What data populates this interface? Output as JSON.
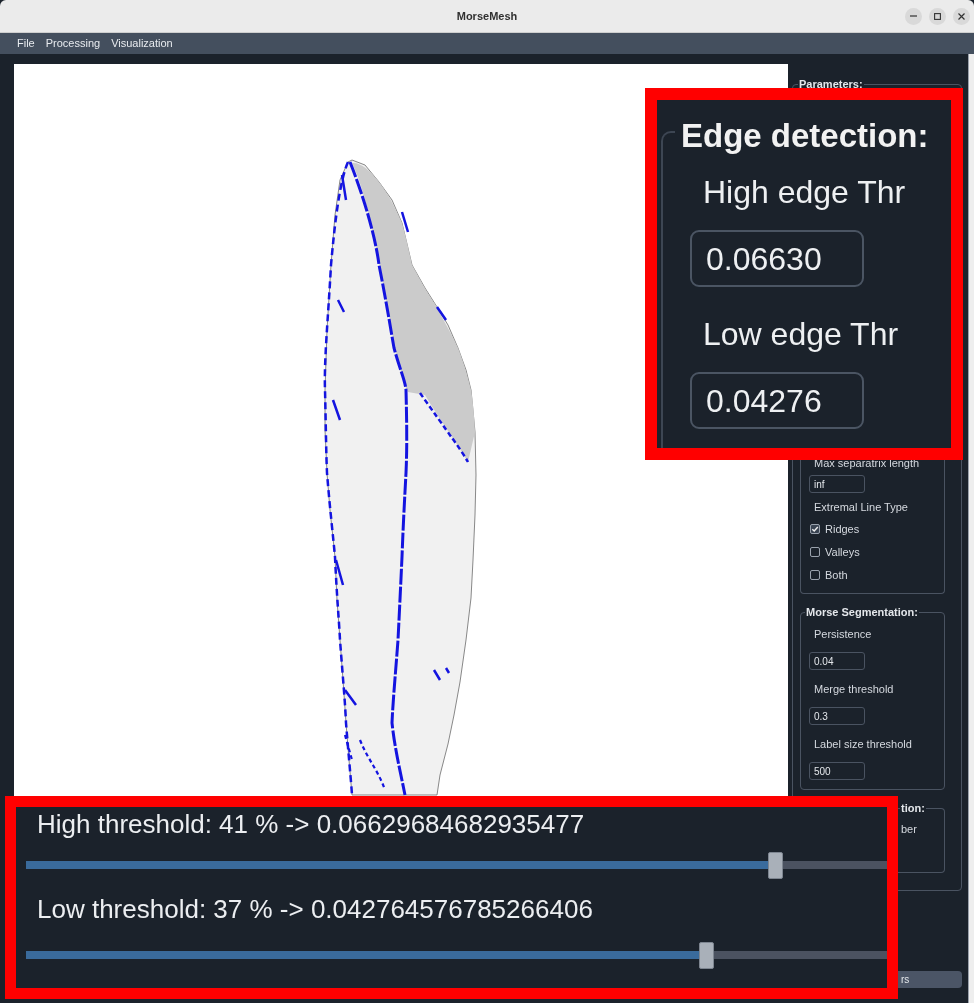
{
  "window": {
    "title": "MorseMesh"
  },
  "menu_bar": {
    "items": [
      {
        "label": "File"
      },
      {
        "label": "Processing"
      },
      {
        "label": "Visualization"
      }
    ]
  },
  "side_panel": {
    "title": "Parameters:",
    "groups": [
      {
        "kind": "open_top",
        "rows": [
          {
            "kind": "label",
            "text": "Max separatrix length"
          },
          {
            "kind": "field",
            "value": "inf"
          },
          {
            "kind": "label",
            "text": "Extremal Line Type"
          },
          {
            "kind": "checkbox",
            "label": "Ridges",
            "checked": true
          },
          {
            "kind": "checkbox",
            "label": "Valleys",
            "checked": false
          },
          {
            "kind": "checkbox",
            "label": "Both",
            "checked": false
          }
        ]
      },
      {
        "kind": "titled",
        "title": "Morse Segmentation:",
        "rows": [
          {
            "kind": "label",
            "text": "Persistence"
          },
          {
            "kind": "field",
            "value": "0.04"
          },
          {
            "kind": "label",
            "text": "Merge threshold"
          },
          {
            "kind": "field",
            "value": "0.3"
          },
          {
            "kind": "label",
            "text": "Label size threshold"
          },
          {
            "kind": "field",
            "value": "500"
          }
        ]
      },
      {
        "kind": "partial",
        "title": "tion:",
        "rows": [
          {
            "kind": "label",
            "text": "ber"
          }
        ]
      }
    ],
    "button": {
      "label": "rs"
    }
  },
  "callouts": [
    {
      "kind": "edge_detection",
      "title": "Edge detection:",
      "rows": [
        {
          "kind": "label",
          "text": "High edge Thr"
        },
        {
          "kind": "field",
          "value": "0.06630"
        },
        {
          "kind": "label",
          "text": "Low edge Thr"
        },
        {
          "kind": "field",
          "value": "0.04276"
        }
      ]
    },
    {
      "kind": "sliders",
      "sliders": [
        {
          "label": "High threshold: 41 % -> 0.06629684682935477",
          "level": 0.87
        },
        {
          "label": "Low threshold: 37 % -> 0.042764576785266406",
          "level": 0.79
        }
      ]
    }
  ]
}
